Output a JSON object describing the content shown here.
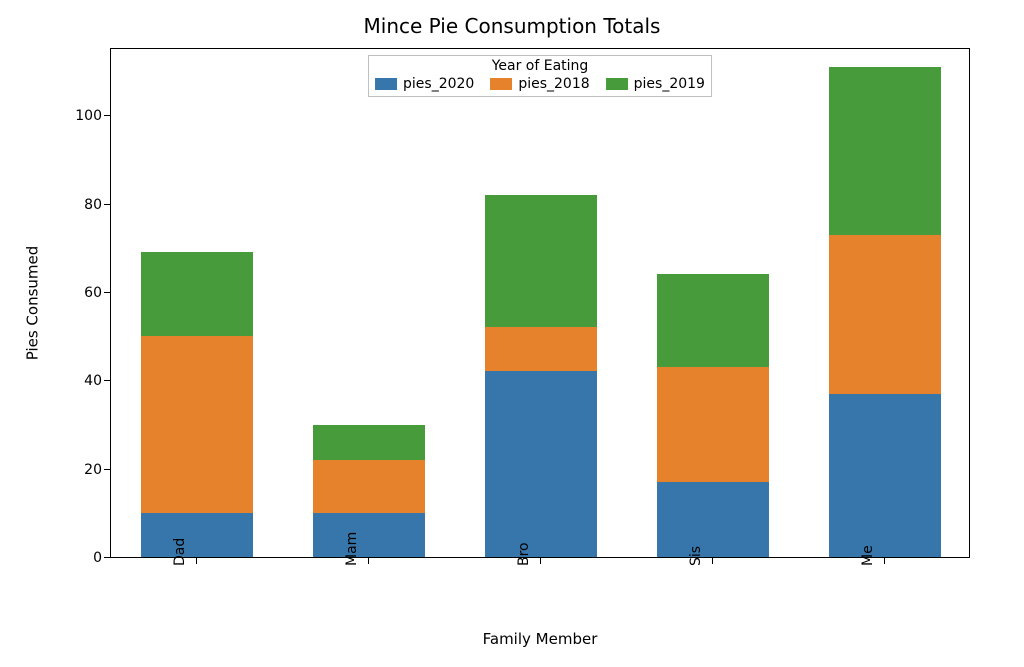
{
  "chart_data": {
    "type": "bar",
    "stacked": true,
    "title": "Mince Pie Consumption Totals",
    "xlabel": "Family Member",
    "ylabel": "Pies Consumed",
    "legend_title": "Year of Eating",
    "categories": [
      "Dad",
      "Mam",
      "Bro",
      "Sis",
      "Me"
    ],
    "series": [
      {
        "name": "pies_2020",
        "color": "#3776ab",
        "values": [
          10,
          10,
          42,
          17,
          37
        ]
      },
      {
        "name": "pies_2018",
        "color": "#e6812c",
        "values": [
          40,
          12,
          10,
          26,
          36
        ]
      },
      {
        "name": "pies_2019",
        "color": "#489b3b",
        "values": [
          19,
          8,
          30,
          21,
          38
        ]
      }
    ],
    "totals": [
      69,
      30,
      82,
      64,
      111
    ],
    "y_ticks": [
      0,
      20,
      40,
      60,
      80,
      100
    ],
    "ylim": [
      0,
      115
    ],
    "x_tick_rotation": 90
  },
  "colors": {
    "blue": "#3776ab",
    "orange": "#e6812c",
    "green": "#489b3b"
  }
}
